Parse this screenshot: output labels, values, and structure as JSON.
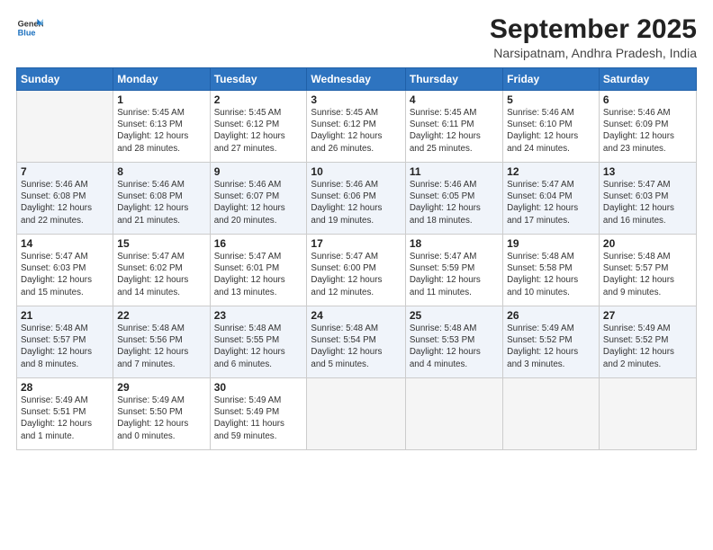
{
  "logo": {
    "line1": "General",
    "line2": "Blue"
  },
  "title": "September 2025",
  "subtitle": "Narsipatnam, Andhra Pradesh, India",
  "weekdays": [
    "Sunday",
    "Monday",
    "Tuesday",
    "Wednesday",
    "Thursday",
    "Friday",
    "Saturday"
  ],
  "weeks": [
    [
      {
        "day": "",
        "info": ""
      },
      {
        "day": "1",
        "info": "Sunrise: 5:45 AM\nSunset: 6:13 PM\nDaylight: 12 hours\nand 28 minutes."
      },
      {
        "day": "2",
        "info": "Sunrise: 5:45 AM\nSunset: 6:12 PM\nDaylight: 12 hours\nand 27 minutes."
      },
      {
        "day": "3",
        "info": "Sunrise: 5:45 AM\nSunset: 6:12 PM\nDaylight: 12 hours\nand 26 minutes."
      },
      {
        "day": "4",
        "info": "Sunrise: 5:45 AM\nSunset: 6:11 PM\nDaylight: 12 hours\nand 25 minutes."
      },
      {
        "day": "5",
        "info": "Sunrise: 5:46 AM\nSunset: 6:10 PM\nDaylight: 12 hours\nand 24 minutes."
      },
      {
        "day": "6",
        "info": "Sunrise: 5:46 AM\nSunset: 6:09 PM\nDaylight: 12 hours\nand 23 minutes."
      }
    ],
    [
      {
        "day": "7",
        "info": "Sunrise: 5:46 AM\nSunset: 6:08 PM\nDaylight: 12 hours\nand 22 minutes."
      },
      {
        "day": "8",
        "info": "Sunrise: 5:46 AM\nSunset: 6:08 PM\nDaylight: 12 hours\nand 21 minutes."
      },
      {
        "day": "9",
        "info": "Sunrise: 5:46 AM\nSunset: 6:07 PM\nDaylight: 12 hours\nand 20 minutes."
      },
      {
        "day": "10",
        "info": "Sunrise: 5:46 AM\nSunset: 6:06 PM\nDaylight: 12 hours\nand 19 minutes."
      },
      {
        "day": "11",
        "info": "Sunrise: 5:46 AM\nSunset: 6:05 PM\nDaylight: 12 hours\nand 18 minutes."
      },
      {
        "day": "12",
        "info": "Sunrise: 5:47 AM\nSunset: 6:04 PM\nDaylight: 12 hours\nand 17 minutes."
      },
      {
        "day": "13",
        "info": "Sunrise: 5:47 AM\nSunset: 6:03 PM\nDaylight: 12 hours\nand 16 minutes."
      }
    ],
    [
      {
        "day": "14",
        "info": "Sunrise: 5:47 AM\nSunset: 6:03 PM\nDaylight: 12 hours\nand 15 minutes."
      },
      {
        "day": "15",
        "info": "Sunrise: 5:47 AM\nSunset: 6:02 PM\nDaylight: 12 hours\nand 14 minutes."
      },
      {
        "day": "16",
        "info": "Sunrise: 5:47 AM\nSunset: 6:01 PM\nDaylight: 12 hours\nand 13 minutes."
      },
      {
        "day": "17",
        "info": "Sunrise: 5:47 AM\nSunset: 6:00 PM\nDaylight: 12 hours\nand 12 minutes."
      },
      {
        "day": "18",
        "info": "Sunrise: 5:47 AM\nSunset: 5:59 PM\nDaylight: 12 hours\nand 11 minutes."
      },
      {
        "day": "19",
        "info": "Sunrise: 5:48 AM\nSunset: 5:58 PM\nDaylight: 12 hours\nand 10 minutes."
      },
      {
        "day": "20",
        "info": "Sunrise: 5:48 AM\nSunset: 5:57 PM\nDaylight: 12 hours\nand 9 minutes."
      }
    ],
    [
      {
        "day": "21",
        "info": "Sunrise: 5:48 AM\nSunset: 5:57 PM\nDaylight: 12 hours\nand 8 minutes."
      },
      {
        "day": "22",
        "info": "Sunrise: 5:48 AM\nSunset: 5:56 PM\nDaylight: 12 hours\nand 7 minutes."
      },
      {
        "day": "23",
        "info": "Sunrise: 5:48 AM\nSunset: 5:55 PM\nDaylight: 12 hours\nand 6 minutes."
      },
      {
        "day": "24",
        "info": "Sunrise: 5:48 AM\nSunset: 5:54 PM\nDaylight: 12 hours\nand 5 minutes."
      },
      {
        "day": "25",
        "info": "Sunrise: 5:48 AM\nSunset: 5:53 PM\nDaylight: 12 hours\nand 4 minutes."
      },
      {
        "day": "26",
        "info": "Sunrise: 5:49 AM\nSunset: 5:52 PM\nDaylight: 12 hours\nand 3 minutes."
      },
      {
        "day": "27",
        "info": "Sunrise: 5:49 AM\nSunset: 5:52 PM\nDaylight: 12 hours\nand 2 minutes."
      }
    ],
    [
      {
        "day": "28",
        "info": "Sunrise: 5:49 AM\nSunset: 5:51 PM\nDaylight: 12 hours\nand 1 minute."
      },
      {
        "day": "29",
        "info": "Sunrise: 5:49 AM\nSunset: 5:50 PM\nDaylight: 12 hours\nand 0 minutes."
      },
      {
        "day": "30",
        "info": "Sunrise: 5:49 AM\nSunset: 5:49 PM\nDaylight: 11 hours\nand 59 minutes."
      },
      {
        "day": "",
        "info": ""
      },
      {
        "day": "",
        "info": ""
      },
      {
        "day": "",
        "info": ""
      },
      {
        "day": "",
        "info": ""
      }
    ]
  ]
}
